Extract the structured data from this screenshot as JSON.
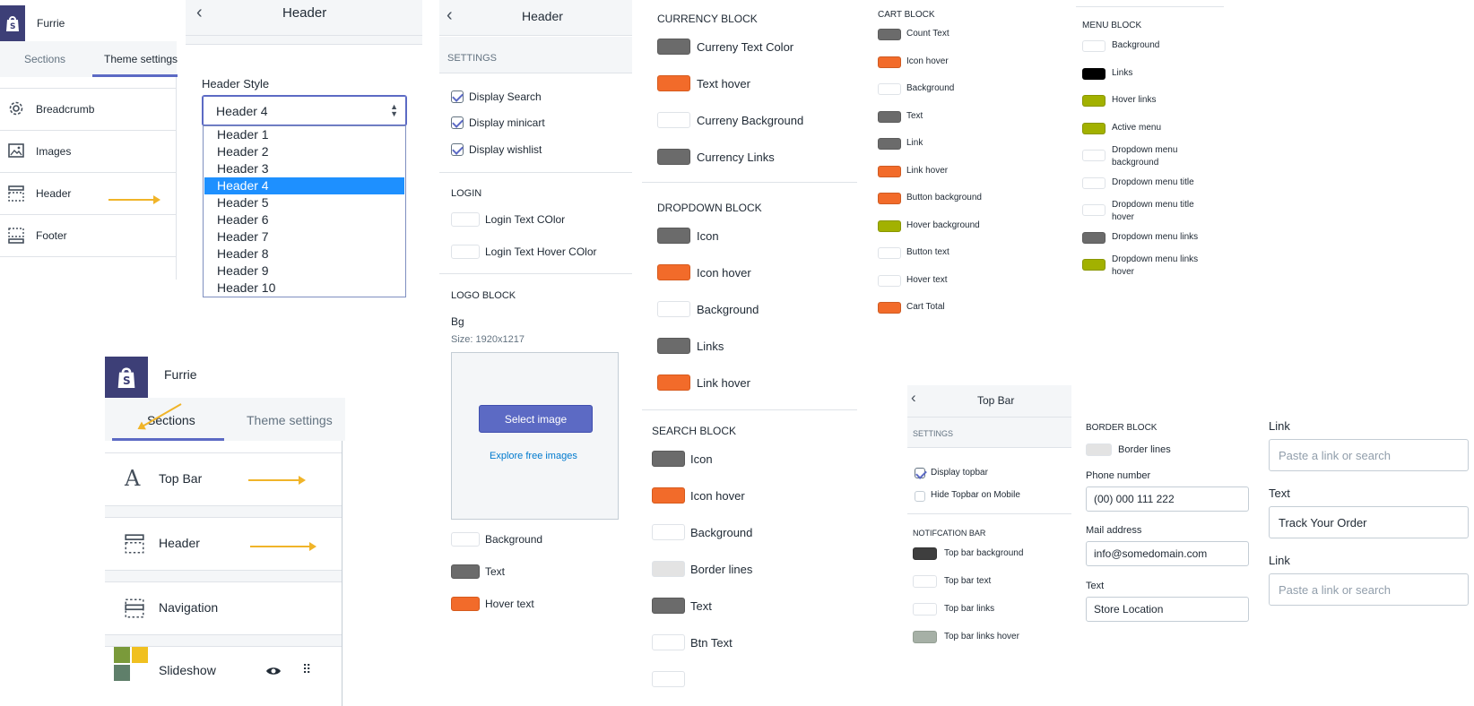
{
  "colors": {
    "dark": "#6b6b6b",
    "orange": "#f26b2a",
    "white": "#ffffff",
    "lime": "#a2b100",
    "black": "#000000",
    "light": "#e3e3e3",
    "darker": "#3e3e3e",
    "sage": "#a6b0a6",
    "accent": "#5c6ac4",
    "selected": "#1e90ff"
  },
  "p1": {
    "store_name": "Furrie",
    "tab_sections": "Sections",
    "tab_theme": "Theme settings",
    "items": [
      {
        "label": "Breadcrumb",
        "icon": "gear-icon"
      },
      {
        "label": "Images",
        "icon": "image-icon"
      },
      {
        "label": "Header",
        "icon": "header-layout-icon"
      },
      {
        "label": "Footer",
        "icon": "footer-layout-icon"
      }
    ]
  },
  "p2": {
    "title": "Header",
    "field_label": "Header Style",
    "selected": "Header 4",
    "options": [
      "Header 1",
      "Header 2",
      "Header 3",
      "Header 4",
      "Header 5",
      "Header 6",
      "Header 7",
      "Header 8",
      "Header 9",
      "Header 10"
    ]
  },
  "p3": {
    "title": "Header",
    "settings_caption": "SETTINGS",
    "checks": [
      {
        "label": "Display Search",
        "checked": true
      },
      {
        "label": "Display minicart",
        "checked": true
      },
      {
        "label": "Display wishlist",
        "checked": true
      }
    ],
    "login_caption": "LOGIN",
    "login_colors": [
      {
        "label": "Login Text COlor",
        "color": "white"
      },
      {
        "label": "Login Text Hover COlor",
        "color": "white"
      }
    ],
    "logo_caption": "LOGO BLOCK",
    "bg_label": "Bg",
    "size_label": "Size: 1920x1217",
    "select_image": "Select image",
    "explore": "Explore free images",
    "logo_colors": [
      {
        "label": "Background",
        "color": "white"
      },
      {
        "label": "Text",
        "color": "dark"
      },
      {
        "label": "Hover text",
        "color": "orange"
      }
    ]
  },
  "p4": {
    "currency_caption": "CURRENCY BLOCK",
    "currency": [
      {
        "label": "Curreny Text Color",
        "color": "dark"
      },
      {
        "label": "Text hover",
        "color": "orange"
      },
      {
        "label": "Curreny Background",
        "color": "white"
      },
      {
        "label": "Currency Links",
        "color": "dark"
      }
    ],
    "dropdown_caption": "DROPDOWN BLOCK",
    "dropdown": [
      {
        "label": "Icon",
        "color": "dark"
      },
      {
        "label": "Icon hover",
        "color": "orange"
      },
      {
        "label": "Background",
        "color": "white"
      },
      {
        "label": "Links",
        "color": "dark"
      },
      {
        "label": "Link hover",
        "color": "orange"
      }
    ],
    "search_caption": "SEARCH BLOCK",
    "search": [
      {
        "label": "Icon",
        "color": "dark"
      },
      {
        "label": "Icon hover",
        "color": "orange"
      },
      {
        "label": "Background",
        "color": "white"
      },
      {
        "label": "Border lines",
        "color": "light"
      },
      {
        "label": "Text",
        "color": "dark"
      },
      {
        "label": "Btn Text",
        "color": "white"
      }
    ]
  },
  "p5": {
    "caption": "CART BLOCK",
    "items": [
      {
        "label": "Count Text",
        "color": "dark"
      },
      {
        "label": "Icon hover",
        "color": "orange"
      },
      {
        "label": "Background",
        "color": "white"
      },
      {
        "label": "Text",
        "color": "dark"
      },
      {
        "label": "Link",
        "color": "dark"
      },
      {
        "label": "Link hover",
        "color": "orange"
      },
      {
        "label": "Button background",
        "color": "orange"
      },
      {
        "label": "Hover background",
        "color": "lime"
      },
      {
        "label": "Button text",
        "color": "white"
      },
      {
        "label": "Hover text",
        "color": "white"
      },
      {
        "label": "Cart Total",
        "color": "orange"
      }
    ]
  },
  "p6": {
    "caption": "MENU BLOCK",
    "items": [
      {
        "label": "Background",
        "color": "white"
      },
      {
        "label": "Links",
        "color": "black"
      },
      {
        "label": "Hover links",
        "color": "lime"
      },
      {
        "label": "Active menu",
        "color": "lime"
      },
      {
        "label": "Dropdown menu background",
        "line1": "Dropdown menu",
        "line2": "background",
        "color": "white"
      },
      {
        "label": "Dropdown menu title",
        "color": "white"
      },
      {
        "label": "Dropdown menu title hover",
        "line1": "Dropdown menu title",
        "line2": "hover",
        "color": "white"
      },
      {
        "label": "Dropdown menu links",
        "color": "dark"
      },
      {
        "label": "Dropdown menu links hover",
        "line1": "Dropdown menu links",
        "line2": "hover",
        "color": "lime"
      }
    ]
  },
  "p7": {
    "store_name": "Furrie",
    "tab_sections": "Sections",
    "tab_theme": "Theme settings",
    "items": [
      {
        "label": "Top Bar",
        "icon": "typography-icon"
      },
      {
        "label": "Header",
        "icon": "header-layout-icon"
      },
      {
        "label": "Navigation",
        "icon": "navigation-layout-icon"
      },
      {
        "label": "Slideshow",
        "icon": "slideshow-thumbnail-icon"
      }
    ]
  },
  "p8": {
    "title": "Top Bar",
    "settings_caption": "SETTINGS",
    "checks": [
      {
        "label": "Display topbar",
        "checked": true
      },
      {
        "label": "Hide Topbar on Mobile",
        "checked": false
      }
    ],
    "notif_caption": "NOTIFCATION BAR",
    "colors": [
      {
        "label": "Top bar background",
        "color": "darker"
      },
      {
        "label": "Top bar text",
        "color": "white"
      },
      {
        "label": "Top bar links",
        "color": "white"
      },
      {
        "label": "Top bar links hover",
        "color": "sage"
      }
    ]
  },
  "p9": {
    "border_caption": "BORDER BLOCK",
    "border_label": "Border lines",
    "border_color": "light",
    "phone_label": "Phone number",
    "phone_value": "(00) 000 111 222",
    "mail_label": "Mail address",
    "mail_value": "info@somedomain.com",
    "text_label": "Text",
    "text_value": "Store Location"
  },
  "p10": {
    "link1_label": "Link",
    "link1_placeholder": "Paste a link or search",
    "text_label": "Text",
    "text_value": "Track Your Order",
    "link2_label": "Link",
    "link2_placeholder": "Paste a link or search"
  }
}
